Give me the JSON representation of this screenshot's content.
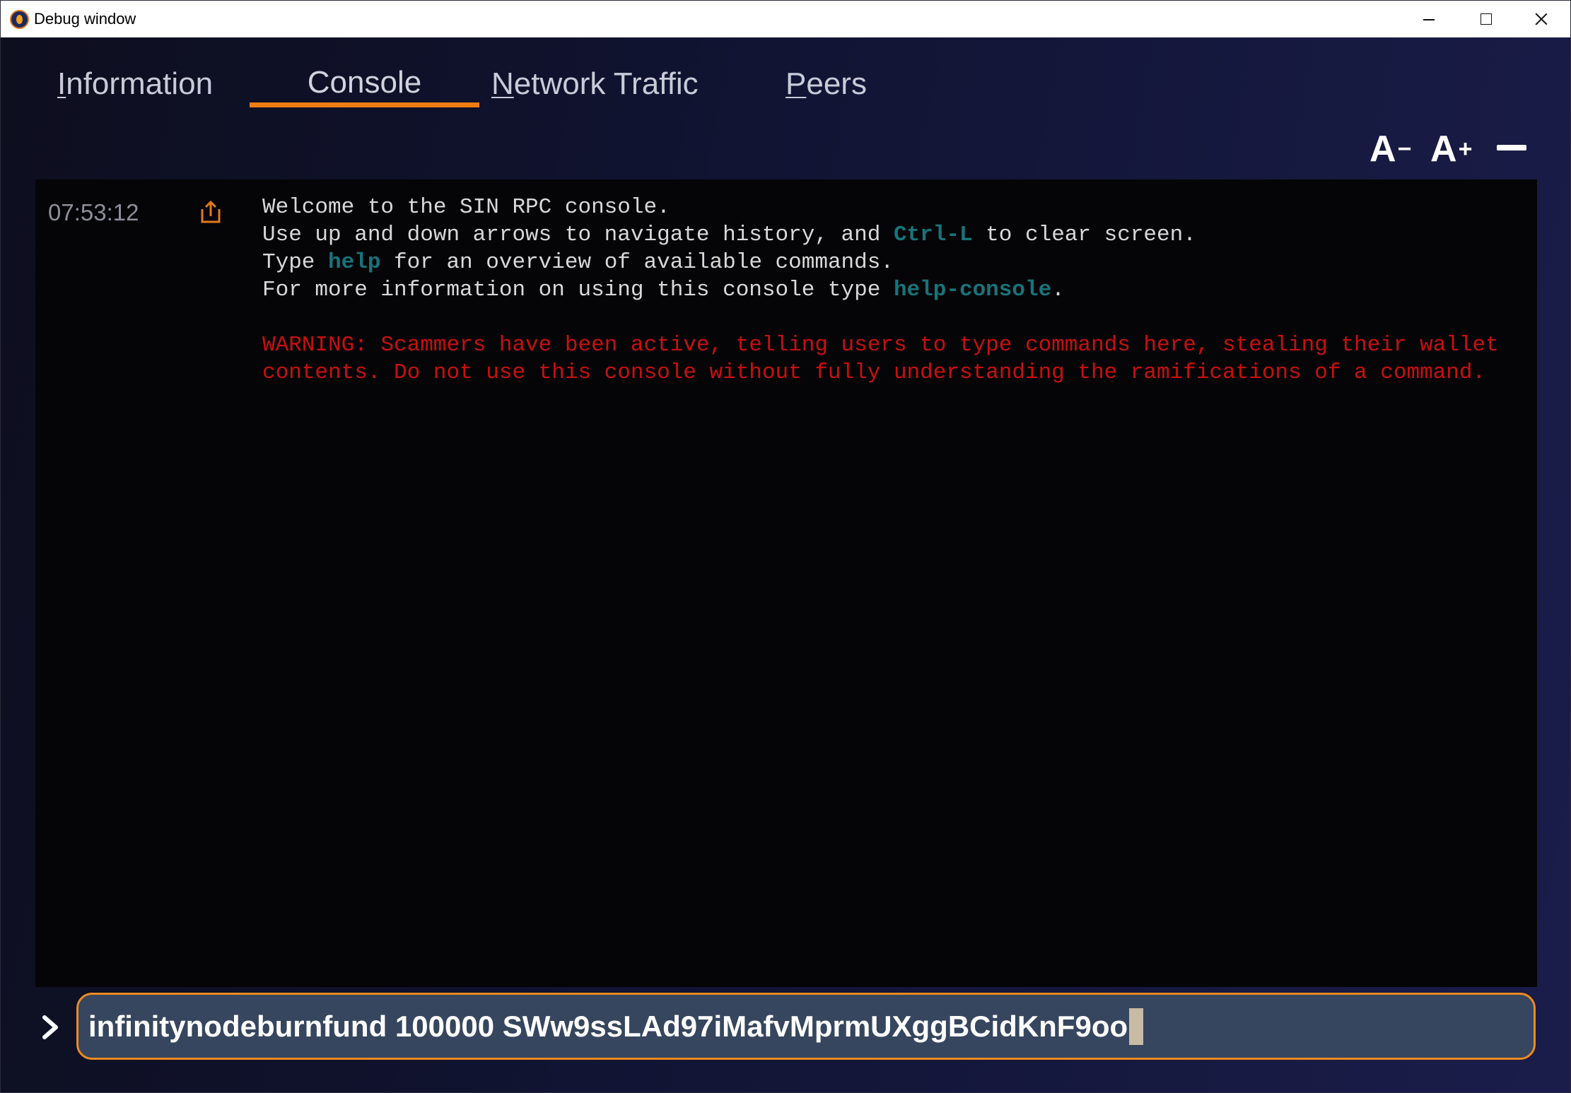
{
  "window": {
    "title": "Debug window"
  },
  "tabs": [
    {
      "label_first": "I",
      "label_rest": "nformation",
      "active": false
    },
    {
      "label_first": "",
      "label_rest": "Console",
      "active": true
    },
    {
      "label_first": "N",
      "label_rest": "etwork Traffic",
      "active": false
    },
    {
      "label_first": "P",
      "label_rest": "eers",
      "active": false
    }
  ],
  "font_controls": {
    "decrease_label": "A",
    "decrease_suffix": "−",
    "increase_label": "A",
    "increase_suffix": "+"
  },
  "console": {
    "timestamp": "07:53:12",
    "lines": {
      "l1": "Welcome to the SIN RPC console.",
      "l2_a": "Use up and down arrows to navigate history, and ",
      "l2_kw": "Ctrl-L",
      "l2_b": " to clear screen.",
      "l3_a": "Type ",
      "l3_kw": "help",
      "l3_b": " for an overview of available commands.",
      "l4_a": "For more information on using this console type ",
      "l4_kw": "help-console",
      "l4_b": ".",
      "warning": "WARNING: Scammers have been active, telling users to type commands here, stealing their wallet contents. Do not use this console without fully understanding the ramifications of a command."
    }
  },
  "input": {
    "value": "infinitynodeburnfund 100000 SWw9ssLAd97iMafvMprmUXggBCidKnF9oo"
  },
  "colors": {
    "accent": "#f07d12",
    "keyword": "#17747a",
    "warning": "#c90f0f",
    "input_bg": "#36465e"
  },
  "icons": {
    "app": "app-logo-icon",
    "reply": "reply-icon",
    "prompt": "chevron-right-icon"
  }
}
